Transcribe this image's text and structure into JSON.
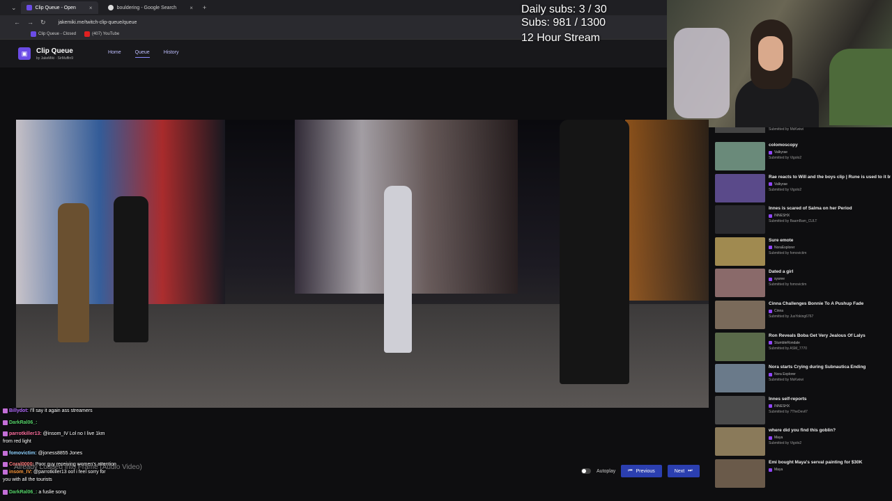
{
  "browser": {
    "tabs": [
      {
        "label": "Clip Queue - Open",
        "active": true
      },
      {
        "label": "bouldering - Google Search",
        "active": false
      }
    ],
    "new_tab_label": "+",
    "close_label": "×",
    "url": "jakemiki.me/twitch-clip-queue/queue",
    "bookmarks": [
      "Clip Queue - Closed",
      "(407) YouTube"
    ]
  },
  "app": {
    "title": "Clip Queue",
    "subtitle": "by JakeMiki · SirMuffin9",
    "nav": [
      {
        "label": "Home",
        "active": false
      },
      {
        "label": "Queue",
        "active": true
      },
      {
        "label": "History",
        "active": false
      }
    ]
  },
  "overlay": {
    "daily_subs": "Daily subs: 3 / 30",
    "subs": "Subs: 981 / 1300",
    "stream": "12 Hour Stream"
  },
  "controls": {
    "autoplay": "Autoplay",
    "previous": "Previous",
    "next": "Next"
  },
  "queue": {
    "top_submitter": "Submitted by MsKwiwi",
    "items": [
      {
        "title": "colomoscopy",
        "channel": "Valkyrae",
        "submitter": "Submitted by Vigolo2",
        "color": "#6a8a7a"
      },
      {
        "title": "Rae reacts to Will and the boys clip | Rune is used to it btw",
        "channel": "Valkyrae",
        "submitter": "Submitted by Vigolo2",
        "color": "#5a4a8a"
      },
      {
        "title": "Innes is scared of Salma on her Period",
        "channel": "INNESHX",
        "submitter": "Submitted by BaamBam_CULT",
        "color": "#2a2a2e"
      },
      {
        "title": "Sure emote",
        "channel": "NoraExplorer",
        "submitter": "Submitted by fomovictim",
        "color": "#a08a50"
      },
      {
        "title": "Dated a girl",
        "channel": "syaree",
        "submitter": "Submitted by fomovictim",
        "color": "#8a6a6a"
      },
      {
        "title": "Cinna Challenges Bonnie To A Pushup Fade",
        "channel": "Cinna",
        "submitter": "Submitted by JusYoking6767",
        "color": "#7a6a5a"
      },
      {
        "title": "Ron Reveals Boba Get Very Jealous Of Lalys",
        "channel": "StumbleRondale",
        "submitter": "Submitted by ASM_7770",
        "color": "#5a6a4a"
      },
      {
        "title": "Nora starts Crying during Subnautica Ending",
        "channel": "Nora Explorer",
        "submitter": "Submitted by MsKwiwi",
        "color": "#6a7a8a"
      },
      {
        "title": "Innes self-reports",
        "channel": "INNESHX",
        "submitter": "Submitted by 7TheDevil7",
        "color": "#4a4a4a"
      },
      {
        "title": "where did you find this goblin?",
        "channel": "Maya",
        "submitter": "Submitted by Vigolo2",
        "color": "#8a7a5a"
      },
      {
        "title": "Emi bought Maya's serval painting for $30K",
        "channel": "Maya",
        "submitter": "",
        "color": "#6a5a4a"
      }
    ]
  },
  "chat": [
    {
      "user": "Billydot:",
      "text": "I'll say it again ass streamers",
      "color": "#b46cff"
    },
    {
      "user": "DarkRal06_:",
      "text": "",
      "color": "#56d66a"
    },
    {
      "user": "parrotkiller13:",
      "text": "@insom_IV Lol no I live 1km",
      "color": "#ff6f9f"
    },
    {
      "user": "",
      "text": "from red light",
      "color": "#ffffff"
    },
    {
      "user": "fomovictim:",
      "text": "@joness8855 Jones",
      "color": "#8fd2ff"
    },
    {
      "user": "Coral0000:",
      "text": "Poor guy receiving women's attention",
      "color": "#ff7b7b"
    },
    {
      "user": "insom_IV:",
      "text": "@parrotkiller13 oof i feel sorry for",
      "color": "#ff9a3c"
    },
    {
      "user": "",
      "text": "you with all the tourists",
      "color": "#ffffff"
    },
    {
      "user": "DarkRal06_:",
      "text": "a fuslie song",
      "color": "#56d66a"
    }
  ],
  "ghost_text": "Already Loaded into Frame (Audio Video)"
}
